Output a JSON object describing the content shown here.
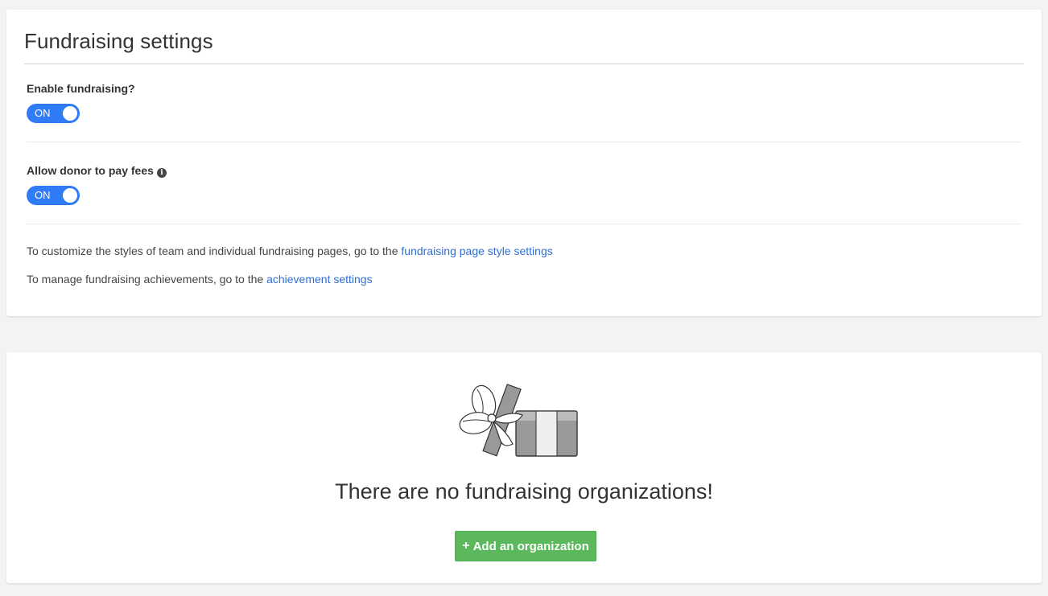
{
  "settings": {
    "title": "Fundraising settings",
    "enable_fundraising": {
      "label": "Enable fundraising?",
      "toggle_text": "ON",
      "on": true
    },
    "donor_pay_fees": {
      "label": "Allow donor to pay fees",
      "toggle_text": "ON",
      "on": true,
      "info_icon": "info-circle-icon"
    },
    "styles_line": {
      "prefix": "To customize the styles of team and individual fundraising pages, go to the ",
      "link": "fundraising page style settings"
    },
    "achievements_line": {
      "prefix": "To manage fundraising achievements, go to the ",
      "link": "achievement settings"
    }
  },
  "organizations": {
    "empty_icon": "gift-box-icon",
    "empty_message": "There are no fundraising organizations!",
    "add_button": {
      "icon": "plus-icon",
      "label": "Add an organization"
    }
  },
  "colors": {
    "toggle_on": "#2f7cf6",
    "link": "#2f6fd4",
    "add_button": "#5cb85c"
  }
}
